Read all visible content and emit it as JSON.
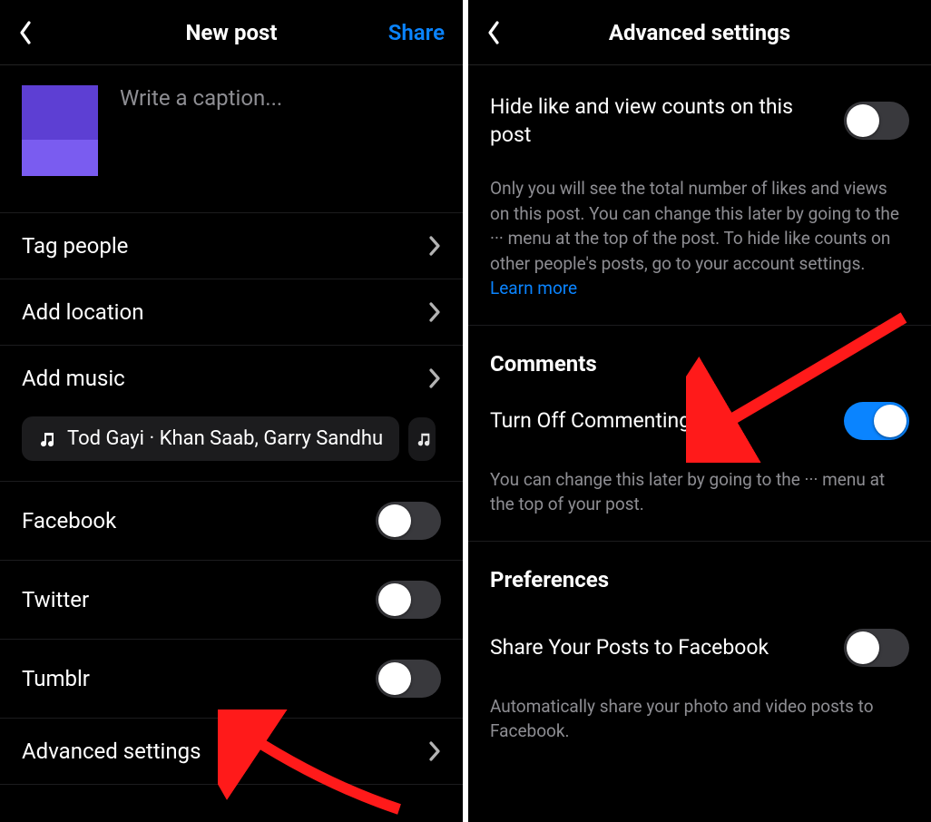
{
  "left": {
    "header": {
      "title": "New post",
      "action": "Share"
    },
    "caption_placeholder": "Write a caption...",
    "rows": {
      "tag_people": "Tag people",
      "add_location": "Add location",
      "add_music": "Add music",
      "advanced": "Advanced settings"
    },
    "music_chip": "Tod Gayi · Khan Saab, Garry Sandhu",
    "share_targets": {
      "facebook": "Facebook",
      "twitter": "Twitter",
      "tumblr": "Tumblr"
    }
  },
  "right": {
    "header": {
      "title": "Advanced settings"
    },
    "hide_likes": {
      "label": "Hide like and view counts on this post",
      "desc_pre": "Only you will see the total number of likes and views on this post. You can change this later by going to the ··· menu at the top of the post. To hide like counts on other people's posts, go to your account settings. ",
      "learn_more": "Learn more"
    },
    "comments": {
      "section": "Comments",
      "toggle_label": "Turn Off Commenting",
      "desc": "You can change this later by going to the ··· menu at the top of your post."
    },
    "prefs": {
      "section": "Preferences",
      "fb_label": "Share Your Posts to Facebook",
      "fb_desc": "Automatically share your photo and video posts to Facebook."
    }
  }
}
